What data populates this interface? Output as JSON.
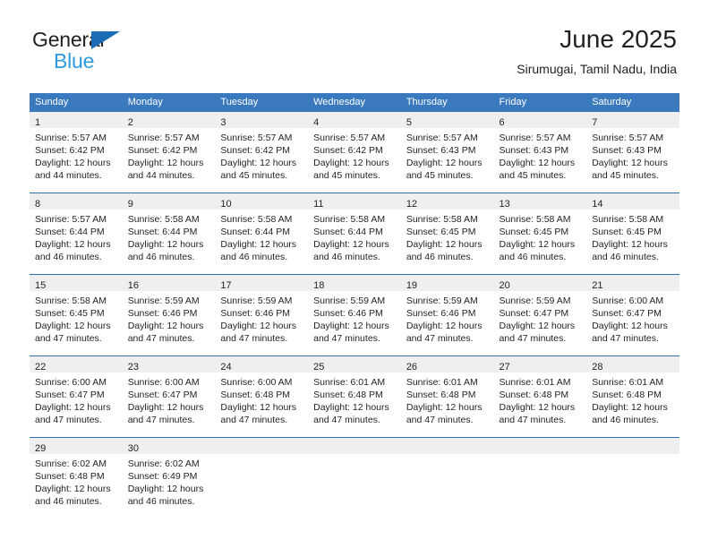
{
  "brand": {
    "name_top": "General",
    "name_bottom": "Blue",
    "triangle_color": "#1b6cb5",
    "bottom_color": "#2e9bdf"
  },
  "header": {
    "title": "June 2025",
    "subtitle": "Sirumugai, Tamil Nadu, India"
  },
  "colors": {
    "header_row_bg": "#3a79bd",
    "row_divider": "#2f6fae",
    "daynum_band_bg": "#efefef",
    "text": "#231f20"
  },
  "weekdays": [
    "Sunday",
    "Monday",
    "Tuesday",
    "Wednesday",
    "Thursday",
    "Friday",
    "Saturday"
  ],
  "weeks": [
    [
      {
        "day": "1",
        "sunrise": "Sunrise: 5:57 AM",
        "sunset": "Sunset: 6:42 PM",
        "daylight1": "Daylight: 12 hours",
        "daylight2": "and 44 minutes."
      },
      {
        "day": "2",
        "sunrise": "Sunrise: 5:57 AM",
        "sunset": "Sunset: 6:42 PM",
        "daylight1": "Daylight: 12 hours",
        "daylight2": "and 44 minutes."
      },
      {
        "day": "3",
        "sunrise": "Sunrise: 5:57 AM",
        "sunset": "Sunset: 6:42 PM",
        "daylight1": "Daylight: 12 hours",
        "daylight2": "and 45 minutes."
      },
      {
        "day": "4",
        "sunrise": "Sunrise: 5:57 AM",
        "sunset": "Sunset: 6:42 PM",
        "daylight1": "Daylight: 12 hours",
        "daylight2": "and 45 minutes."
      },
      {
        "day": "5",
        "sunrise": "Sunrise: 5:57 AM",
        "sunset": "Sunset: 6:43 PM",
        "daylight1": "Daylight: 12 hours",
        "daylight2": "and 45 minutes."
      },
      {
        "day": "6",
        "sunrise": "Sunrise: 5:57 AM",
        "sunset": "Sunset: 6:43 PM",
        "daylight1": "Daylight: 12 hours",
        "daylight2": "and 45 minutes."
      },
      {
        "day": "7",
        "sunrise": "Sunrise: 5:57 AM",
        "sunset": "Sunset: 6:43 PM",
        "daylight1": "Daylight: 12 hours",
        "daylight2": "and 45 minutes."
      }
    ],
    [
      {
        "day": "8",
        "sunrise": "Sunrise: 5:57 AM",
        "sunset": "Sunset: 6:44 PM",
        "daylight1": "Daylight: 12 hours",
        "daylight2": "and 46 minutes."
      },
      {
        "day": "9",
        "sunrise": "Sunrise: 5:58 AM",
        "sunset": "Sunset: 6:44 PM",
        "daylight1": "Daylight: 12 hours",
        "daylight2": "and 46 minutes."
      },
      {
        "day": "10",
        "sunrise": "Sunrise: 5:58 AM",
        "sunset": "Sunset: 6:44 PM",
        "daylight1": "Daylight: 12 hours",
        "daylight2": "and 46 minutes."
      },
      {
        "day": "11",
        "sunrise": "Sunrise: 5:58 AM",
        "sunset": "Sunset: 6:44 PM",
        "daylight1": "Daylight: 12 hours",
        "daylight2": "and 46 minutes."
      },
      {
        "day": "12",
        "sunrise": "Sunrise: 5:58 AM",
        "sunset": "Sunset: 6:45 PM",
        "daylight1": "Daylight: 12 hours",
        "daylight2": "and 46 minutes."
      },
      {
        "day": "13",
        "sunrise": "Sunrise: 5:58 AM",
        "sunset": "Sunset: 6:45 PM",
        "daylight1": "Daylight: 12 hours",
        "daylight2": "and 46 minutes."
      },
      {
        "day": "14",
        "sunrise": "Sunrise: 5:58 AM",
        "sunset": "Sunset: 6:45 PM",
        "daylight1": "Daylight: 12 hours",
        "daylight2": "and 46 minutes."
      }
    ],
    [
      {
        "day": "15",
        "sunrise": "Sunrise: 5:58 AM",
        "sunset": "Sunset: 6:45 PM",
        "daylight1": "Daylight: 12 hours",
        "daylight2": "and 47 minutes."
      },
      {
        "day": "16",
        "sunrise": "Sunrise: 5:59 AM",
        "sunset": "Sunset: 6:46 PM",
        "daylight1": "Daylight: 12 hours",
        "daylight2": "and 47 minutes."
      },
      {
        "day": "17",
        "sunrise": "Sunrise: 5:59 AM",
        "sunset": "Sunset: 6:46 PM",
        "daylight1": "Daylight: 12 hours",
        "daylight2": "and 47 minutes."
      },
      {
        "day": "18",
        "sunrise": "Sunrise: 5:59 AM",
        "sunset": "Sunset: 6:46 PM",
        "daylight1": "Daylight: 12 hours",
        "daylight2": "and 47 minutes."
      },
      {
        "day": "19",
        "sunrise": "Sunrise: 5:59 AM",
        "sunset": "Sunset: 6:46 PM",
        "daylight1": "Daylight: 12 hours",
        "daylight2": "and 47 minutes."
      },
      {
        "day": "20",
        "sunrise": "Sunrise: 5:59 AM",
        "sunset": "Sunset: 6:47 PM",
        "daylight1": "Daylight: 12 hours",
        "daylight2": "and 47 minutes."
      },
      {
        "day": "21",
        "sunrise": "Sunrise: 6:00 AM",
        "sunset": "Sunset: 6:47 PM",
        "daylight1": "Daylight: 12 hours",
        "daylight2": "and 47 minutes."
      }
    ],
    [
      {
        "day": "22",
        "sunrise": "Sunrise: 6:00 AM",
        "sunset": "Sunset: 6:47 PM",
        "daylight1": "Daylight: 12 hours",
        "daylight2": "and 47 minutes."
      },
      {
        "day": "23",
        "sunrise": "Sunrise: 6:00 AM",
        "sunset": "Sunset: 6:47 PM",
        "daylight1": "Daylight: 12 hours",
        "daylight2": "and 47 minutes."
      },
      {
        "day": "24",
        "sunrise": "Sunrise: 6:00 AM",
        "sunset": "Sunset: 6:48 PM",
        "daylight1": "Daylight: 12 hours",
        "daylight2": "and 47 minutes."
      },
      {
        "day": "25",
        "sunrise": "Sunrise: 6:01 AM",
        "sunset": "Sunset: 6:48 PM",
        "daylight1": "Daylight: 12 hours",
        "daylight2": "and 47 minutes."
      },
      {
        "day": "26",
        "sunrise": "Sunrise: 6:01 AM",
        "sunset": "Sunset: 6:48 PM",
        "daylight1": "Daylight: 12 hours",
        "daylight2": "and 47 minutes."
      },
      {
        "day": "27",
        "sunrise": "Sunrise: 6:01 AM",
        "sunset": "Sunset: 6:48 PM",
        "daylight1": "Daylight: 12 hours",
        "daylight2": "and 47 minutes."
      },
      {
        "day": "28",
        "sunrise": "Sunrise: 6:01 AM",
        "sunset": "Sunset: 6:48 PM",
        "daylight1": "Daylight: 12 hours",
        "daylight2": "and 46 minutes."
      }
    ],
    [
      {
        "day": "29",
        "sunrise": "Sunrise: 6:02 AM",
        "sunset": "Sunset: 6:48 PM",
        "daylight1": "Daylight: 12 hours",
        "daylight2": "and 46 minutes."
      },
      {
        "day": "30",
        "sunrise": "Sunrise: 6:02 AM",
        "sunset": "Sunset: 6:49 PM",
        "daylight1": "Daylight: 12 hours",
        "daylight2": "and 46 minutes."
      },
      {
        "day": "",
        "sunrise": "",
        "sunset": "",
        "daylight1": "",
        "daylight2": ""
      },
      {
        "day": "",
        "sunrise": "",
        "sunset": "",
        "daylight1": "",
        "daylight2": ""
      },
      {
        "day": "",
        "sunrise": "",
        "sunset": "",
        "daylight1": "",
        "daylight2": ""
      },
      {
        "day": "",
        "sunrise": "",
        "sunset": "",
        "daylight1": "",
        "daylight2": ""
      },
      {
        "day": "",
        "sunrise": "",
        "sunset": "",
        "daylight1": "",
        "daylight2": ""
      }
    ]
  ]
}
